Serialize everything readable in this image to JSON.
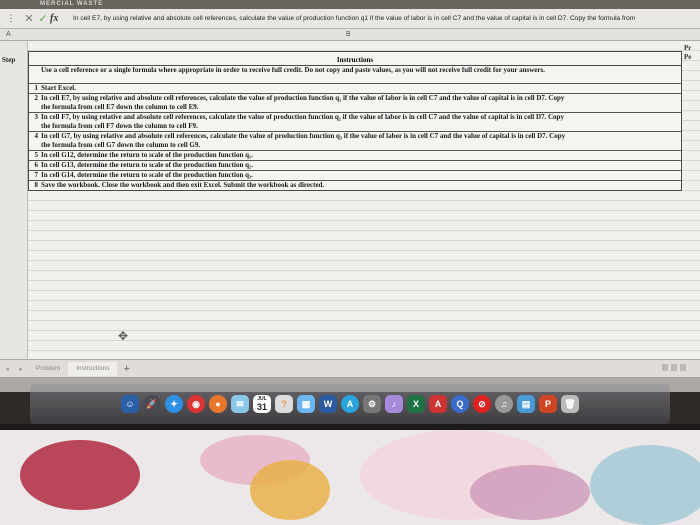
{
  "topstrip": {
    "text": "MERCIAL  WASTE"
  },
  "formula_bar": {
    "name_box": "",
    "cancel": "✕",
    "enter": "✓",
    "fx": "fx",
    "content": "In cell E7, by using relative and absolute cell references, calculate the value of production function q1 if the value of labor is in cell C7 and the value of capital is in cell D7. Copy the formula from"
  },
  "column_headers": {
    "a": "A",
    "b": "B"
  },
  "sheet": {
    "step_header": "Step",
    "instructions_header": "Instructions",
    "right_cut": [
      "Pr",
      "Pe"
    ],
    "intro": "Use a cell reference or a single formula where appropriate in order to receive full credit. Do not copy and paste values, as you will not receive full credit for your answers.",
    "steps": [
      {
        "n": "1",
        "lines": [
          "Start Excel."
        ]
      },
      {
        "n": "2",
        "lines": [
          "In cell E7, by using relative and absolute cell references, calculate the value of production function q₁ if the value of labor is in cell C7 and the value of capital is in cell D7. Copy",
          "the formula from cell E7 down the column to cell E9."
        ]
      },
      {
        "n": "3",
        "lines": [
          "In cell F7, by using relative and absolute cell references, calculate the value of production function q₂ if the value of labor is in cell C7 and the value of capital is in cell D7. Copy",
          "the formula from cell F7 down the column to cell F9."
        ]
      },
      {
        "n": "4",
        "lines": [
          "In cell G7, by using relative and absolute cell references, calculate the value of production function q₃ if the value of labor is in cell C7 and the value of capital is in cell D7. Copy",
          "the formula from cell G7 down the column to cell G9."
        ]
      },
      {
        "n": "5",
        "lines": [
          "In cell G12, determine the return to scale of the production function q₁."
        ]
      },
      {
        "n": "6",
        "lines": [
          "In cell G13, determine the return to scale of the production function q₂."
        ]
      },
      {
        "n": "7",
        "lines": [
          "In cell G14, determine the return to scale of the production function q₃."
        ]
      },
      {
        "n": "8",
        "lines": [
          "Save the workbook. Close the workbook and then exit Excel. Submit the workbook as directed."
        ]
      }
    ]
  },
  "tabs": {
    "items": [
      "Problem",
      "Instructions"
    ],
    "active": "Instructions",
    "add": "+"
  },
  "dock": {
    "calendar_month": "JUL",
    "calendar_day": "31",
    "word_letter": "W",
    "excel_letter": "X",
    "ppt_letter": "P",
    "badge": "17,890"
  }
}
